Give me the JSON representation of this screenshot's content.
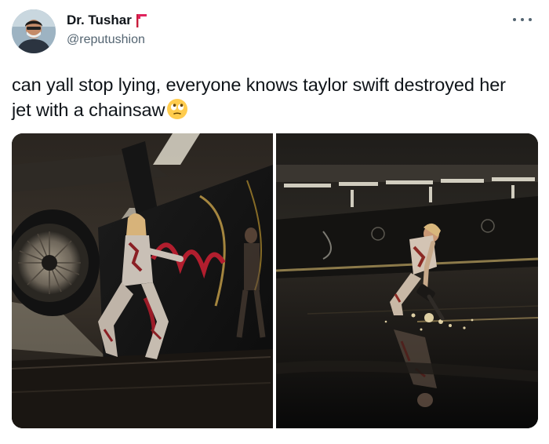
{
  "author": {
    "display_name": "Dr. Tushar",
    "handle": "@reputushion",
    "badge_icon": "red-flag-icon",
    "avatar_icon": "avatar-masked-person"
  },
  "tweet": {
    "text": "can yall stop lying, everyone knows taylor swift destroyed her jet with a chainsaw",
    "emoji_icon": "face-with-rolling-eyes-emoji"
  },
  "menu": {
    "icon": "more-options-icon"
  },
  "media": [
    {
      "name": "photo-performer-on-jet-wing",
      "icon": "photo"
    },
    {
      "name": "photo-performer-with-chainsaw",
      "icon": "photo"
    }
  ],
  "colors": {
    "text_primary": "#0f1419",
    "text_secondary": "#536471",
    "flag_red": "#e0245e",
    "background": "#ffffff"
  }
}
